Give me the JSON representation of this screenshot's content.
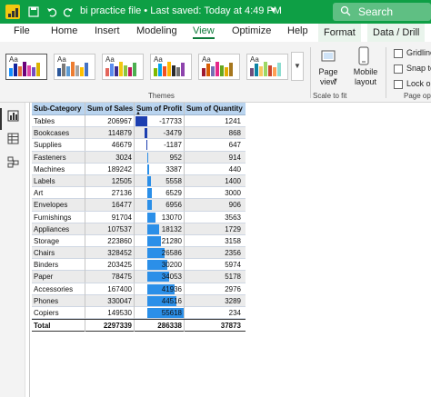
{
  "titlebar": {
    "doc_title": "bi practice file • Last saved: Today at 4:49 PM",
    "search_label": "Search",
    "bg_color": "#0e9f45"
  },
  "menu": {
    "tabs": [
      "File",
      "Home",
      "Insert",
      "Modeling",
      "View",
      "Optimize",
      "Help",
      "Format",
      "Data / Drill"
    ],
    "active_tab": "View"
  },
  "ribbon": {
    "themes_label": "Themes",
    "themes": [
      {
        "aa": "Aa",
        "colors": [
          "#118dff",
          "#12239e",
          "#e66c37",
          "#6b007b",
          "#e044a7",
          "#744ec2",
          "#d9b300"
        ]
      },
      {
        "aa": "Aa",
        "colors": [
          "#2b579a",
          "#7a7a7a",
          "#5b9bd5",
          "#ed7d31",
          "#a5a5a5",
          "#ffc000",
          "#4472c4"
        ]
      },
      {
        "aa": "Aa",
        "colors": [
          "#e3655b",
          "#5b8def",
          "#3e2d8f",
          "#f2c811",
          "#8dc63f",
          "#c2185b",
          "#4caf50"
        ]
      },
      {
        "aa": "Aa",
        "colors": [
          "#7fba00",
          "#00a4ef",
          "#f25022",
          "#ffb900",
          "#2b2b2b",
          "#737373",
          "#8e44ad"
        ]
      },
      {
        "aa": "Aa",
        "colors": [
          "#9e1b32",
          "#d95f02",
          "#7570b3",
          "#e7298a",
          "#66a61e",
          "#e6ab02",
          "#a6761d"
        ]
      },
      {
        "aa": "Aa",
        "colors": [
          "#6f4e7c",
          "#0b84a5",
          "#f6c85f",
          "#9dd866",
          "#ca472f",
          "#ffa056",
          "#8dddd0"
        ]
      }
    ],
    "page_view_label": "Page view",
    "mobile_layout_label": "Mobile layout",
    "scale_group_label": "Scale to fit",
    "gridlines_label": "Gridlines",
    "snap_label": "Snap to",
    "lock_label": "Lock ob",
    "page_options_label": "Page opti"
  },
  "matrix": {
    "headers": [
      "Sub-Category",
      "Sum of Sales",
      "Sum of Profit",
      "Sum of Quantity"
    ],
    "rows": [
      {
        "sub": "Tables",
        "sales": "206967",
        "profit": "-17733",
        "profit_num": -17733,
        "qty": "1241"
      },
      {
        "sub": "Bookcases",
        "sales": "114879",
        "profit": "-3479",
        "profit_num": -3479,
        "qty": "868"
      },
      {
        "sub": "Supplies",
        "sales": "46679",
        "profit": "-1187",
        "profit_num": -1187,
        "qty": "647"
      },
      {
        "sub": "Fasteners",
        "sales": "3024",
        "profit": "952",
        "profit_num": 952,
        "qty": "914"
      },
      {
        "sub": "Machines",
        "sales": "189242",
        "profit": "3387",
        "profit_num": 3387,
        "qty": "440"
      },
      {
        "sub": "Labels",
        "sales": "12505",
        "profit": "5558",
        "profit_num": 5558,
        "qty": "1400"
      },
      {
        "sub": "Art",
        "sales": "27136",
        "profit": "6529",
        "profit_num": 6529,
        "qty": "3000"
      },
      {
        "sub": "Envelopes",
        "sales": "16477",
        "profit": "6956",
        "profit_num": 6956,
        "qty": "906"
      },
      {
        "sub": "Furnishings",
        "sales": "91704",
        "profit": "13070",
        "profit_num": 13070,
        "qty": "3563"
      },
      {
        "sub": "Appliances",
        "sales": "107537",
        "profit": "18132",
        "profit_num": 18132,
        "qty": "1729"
      },
      {
        "sub": "Storage",
        "sales": "223860",
        "profit": "21280",
        "profit_num": 21280,
        "qty": "3158"
      },
      {
        "sub": "Chairs",
        "sales": "328452",
        "profit": "26586",
        "profit_num": 26586,
        "qty": "2356"
      },
      {
        "sub": "Binders",
        "sales": "203425",
        "profit": "30200",
        "profit_num": 30200,
        "qty": "5974"
      },
      {
        "sub": "Paper",
        "sales": "78475",
        "profit": "34053",
        "profit_num": 34053,
        "qty": "5178"
      },
      {
        "sub": "Accessories",
        "sales": "167400",
        "profit": "41936",
        "profit_num": 41936,
        "qty": "2976"
      },
      {
        "sub": "Phones",
        "sales": "330047",
        "profit": "44516",
        "profit_num": 44516,
        "qty": "3289"
      },
      {
        "sub": "Copiers",
        "sales": "149530",
        "profit": "55618",
        "profit_num": 55618,
        "qty": "234"
      }
    ],
    "total": {
      "label": "Total",
      "sales": "2297339",
      "profit": "286338",
      "qty": "37873"
    },
    "bar_positive_color": "#2b8fe8",
    "bar_negative_color": "#1d3fb0",
    "header_bg": "#b9d4ef"
  },
  "sidebar": {
    "icons": [
      "report-view-icon",
      "table-view-icon",
      "model-view-icon"
    ]
  }
}
